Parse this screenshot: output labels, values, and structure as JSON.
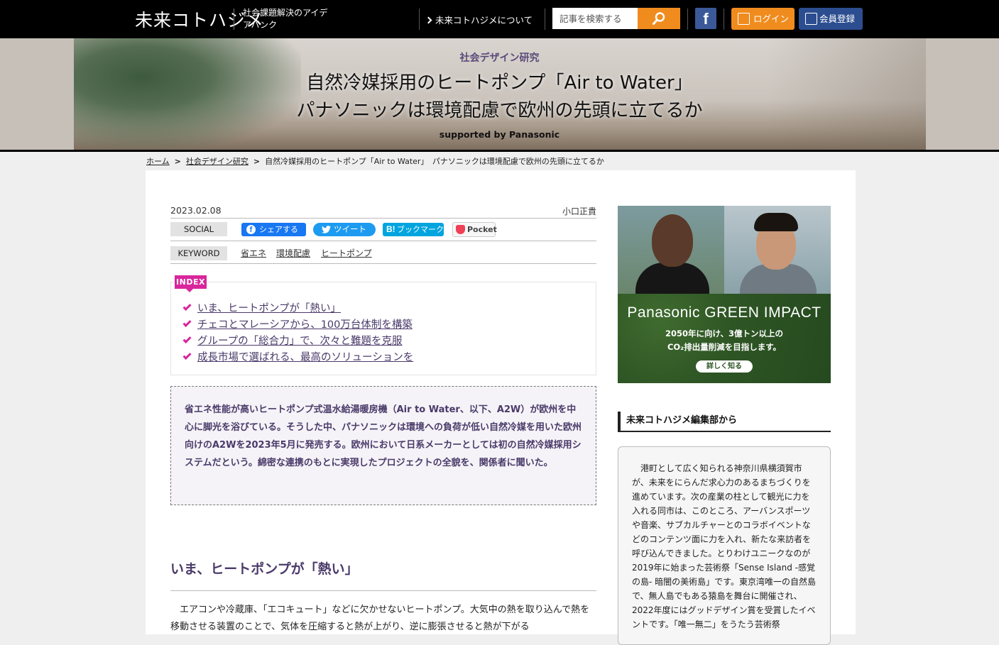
{
  "header": {
    "logo": "未来コトハジメ",
    "tagline": "社会課題解決のアイデアバンク",
    "about_link": "未来コトハジメについて",
    "search_placeholder": "記事を検索する",
    "login_label": "ログイン",
    "register_label": "会員登録",
    "facebook_letter": "f"
  },
  "hero": {
    "category": "社会デザイン研究",
    "title_line1": "自然冷媒採用のヒートポンプ「Air to Water」",
    "title_line2": "パナソニックは環境配慮で欧州の先頭に立てるか",
    "subtitle": "supported by Panasonic"
  },
  "breadcrumb": {
    "home": "ホーム",
    "category": "社会デザイン研究",
    "current": "自然冷媒採用のヒートポンプ「Air to Water」　パナソニックは環境配慮で欧州の先頭に立てるか",
    "separator": ">"
  },
  "article": {
    "date": "2023.02.08",
    "author": "小口正貴",
    "social_label": "SOCIAL",
    "share_facebook": "シェアする",
    "share_twitter": "ツイート",
    "share_hatena_mark": "B!",
    "share_hatena": "ブックマーク",
    "share_pocket": "Pocket",
    "keyword_label": "KEYWORD",
    "keywords": [
      "省エネ",
      "環境配慮",
      "ヒートポンプ"
    ],
    "index_label": "INDEX",
    "index_items": [
      "いま、ヒートポンプが「熱い」",
      "チェコとマレーシアから、100万台体制を構築",
      "グループの「総合力」で、次々と難題を克服",
      "成長市場で選ばれる、最高のソリューションを"
    ],
    "lead": "省エネ性能が高いヒートポンプ式温水給湯暖房機（Air to Water、以下、A2W）が欧州を中心に脚光を浴びている。そうした中、パナソニックは環境への負荷が低い自然冷媒を用いた欧州向けのA2Wを2023年5月に発売する。欧州において日系メーカーとしては初の自然冷媒採用システムだという。綿密な連携のもとに実現したプロジェクトの全貌を、関係者に聞いた。",
    "section1_heading": "いま、ヒートポンプが「熱い」",
    "section1_body": "　エアコンや冷蔵庫、「エコキュート」などに欠かせないヒートポンプ。大気中の熱を取り込んで熱を移動させる装置のことで、気体を圧縮すると熱が上がり、逆に膨張させると熱が下がる"
  },
  "sidebar": {
    "ad": {
      "brand": "Panasonic GREEN IMPACT",
      "copy_line1": "2050年に向け、3億トン以上の",
      "copy_line2": "CO₂排出量削減を目指します。",
      "button": "詳しく知る"
    },
    "editorial_heading": "未来コトハジメ編集部から",
    "editorial_text": "　港町として広く知られる神奈川県横須賀市が、未来をにらんだ求心力のあるまちづくりを進めています。次の産業の柱として観光に力を入れる同市は、このところ、アーバンスポーツや音楽、サブカルチャーとのコラボイベントなどのコンテンツ面に力を入れ、新たな来訪者を呼び込んできました。とりわけユニークなのが2019年に始まった芸術祭「Sense Island -感覚の島- 暗闇の美術島」です。東京湾唯一の自然島で、無人島でもある猿島を舞台に開催され、2022年度にはグッドデザイン賞を受賞したイベントです。「唯一無二」をうたう芸術祭"
  },
  "colors": {
    "accent_orange": "#f08c1e",
    "index_magenta": "#d9259c",
    "heading_purple": "#4a3a6a",
    "register_blue": "#2c4d8f"
  }
}
